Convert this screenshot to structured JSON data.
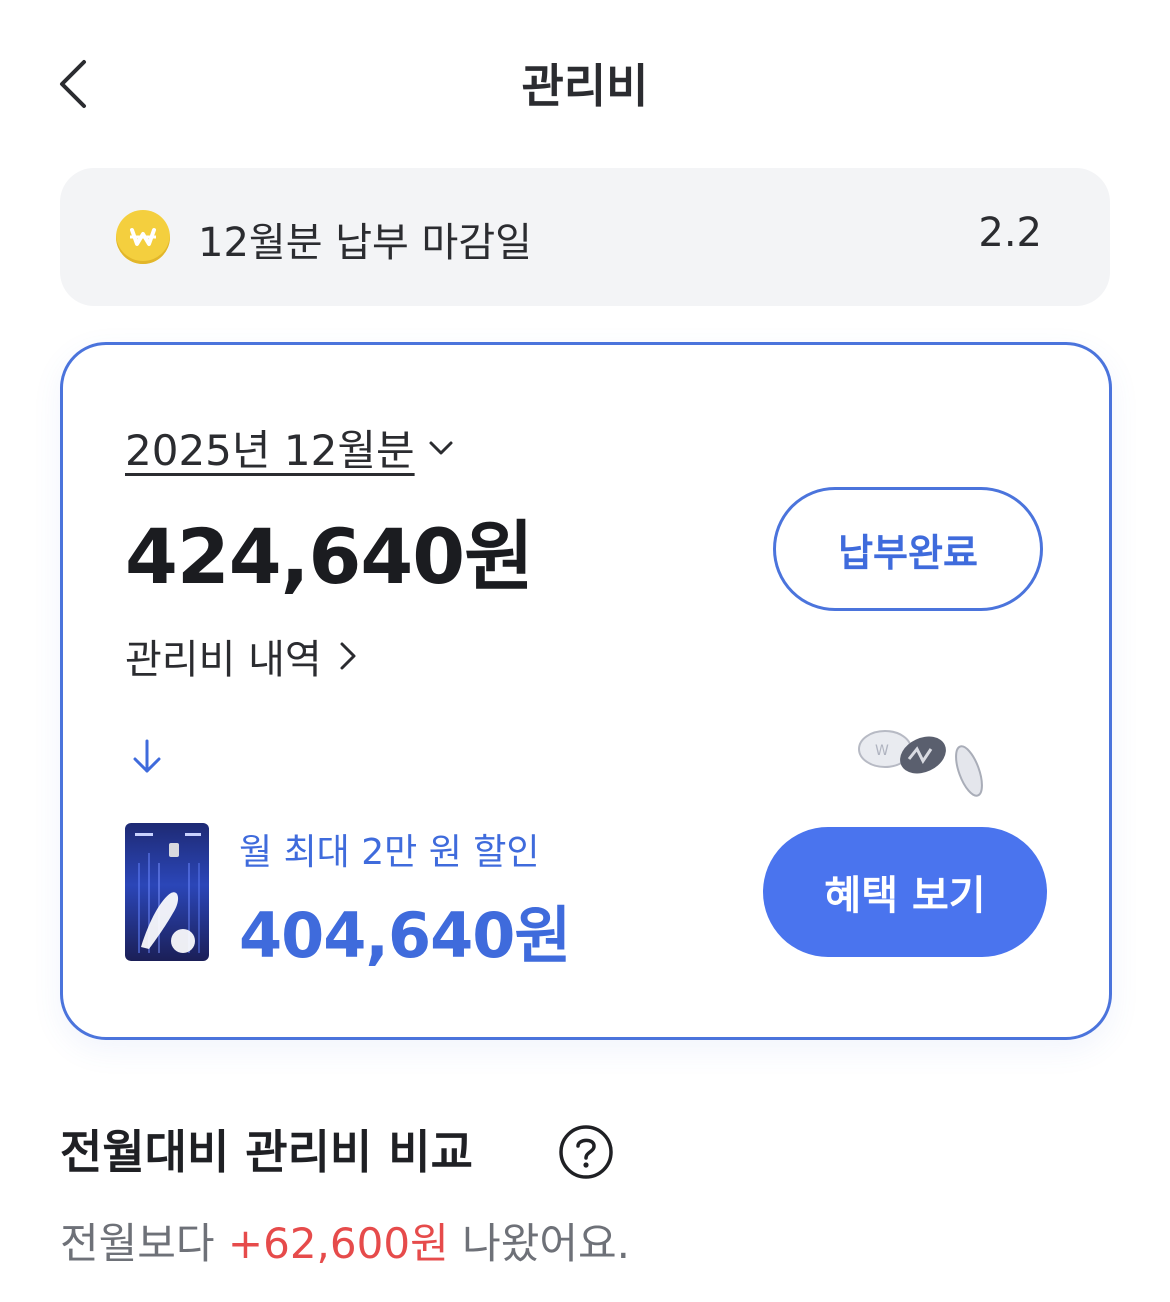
{
  "header": {
    "title": "관리비"
  },
  "due_notice": {
    "label": "12월분 납부 마감일",
    "value": "2.2",
    "coin_symbol": "W"
  },
  "bill": {
    "period": "2025년 12월분",
    "amount": "424,640원",
    "paid_button_label": "납부완료",
    "detail_link_label": "관리비 내역"
  },
  "card_offer": {
    "discount_label": "월 최대 2만 원 할인",
    "discounted_amount": "404,640원",
    "benefit_button_label": "혜택 보기"
  },
  "comparison": {
    "title": "전월대비 관리비 비교",
    "text_prefix": "전월보다 ",
    "difference": "+62,600원",
    "text_suffix": " 나왔어요."
  },
  "colors": {
    "accent": "#4b74dc",
    "button_fill": "#4a74ee",
    "increase": "#e64b4b",
    "coin": "#f4cf3e"
  },
  "icons": [
    "back-icon",
    "won-coin-icon",
    "chevron-down-icon",
    "chevron-right-icon",
    "arrow-down-icon",
    "help-icon"
  ]
}
